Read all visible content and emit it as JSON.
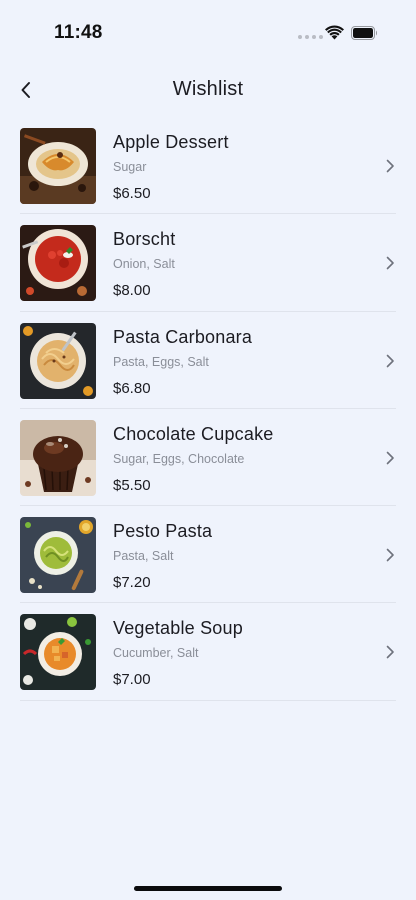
{
  "status_bar": {
    "time": "11:48"
  },
  "header": {
    "title": "Wishlist"
  },
  "items": [
    {
      "name": "Apple Dessert",
      "ingredients": "Sugar",
      "price": "$6.50"
    },
    {
      "name": "Borscht",
      "ingredients": "Onion, Salt",
      "price": "$8.00"
    },
    {
      "name": "Pasta Carbonara",
      "ingredients": "Pasta, Eggs, Salt",
      "price": "$6.80"
    },
    {
      "name": "Chocolate Cupcake",
      "ingredients": "Sugar, Eggs, Chocolate",
      "price": "$5.50"
    },
    {
      "name": "Pesto Pasta",
      "ingredients": "Pasta, Salt",
      "price": "$7.20"
    },
    {
      "name": "Vegetable Soup",
      "ingredients": "Cucumber, Salt",
      "price": "$7.00"
    }
  ],
  "colors": {
    "background": "#eff3fc",
    "text": "#1c1c22",
    "secondary_text": "#8a8e98",
    "divider": "#dfe3ec"
  }
}
